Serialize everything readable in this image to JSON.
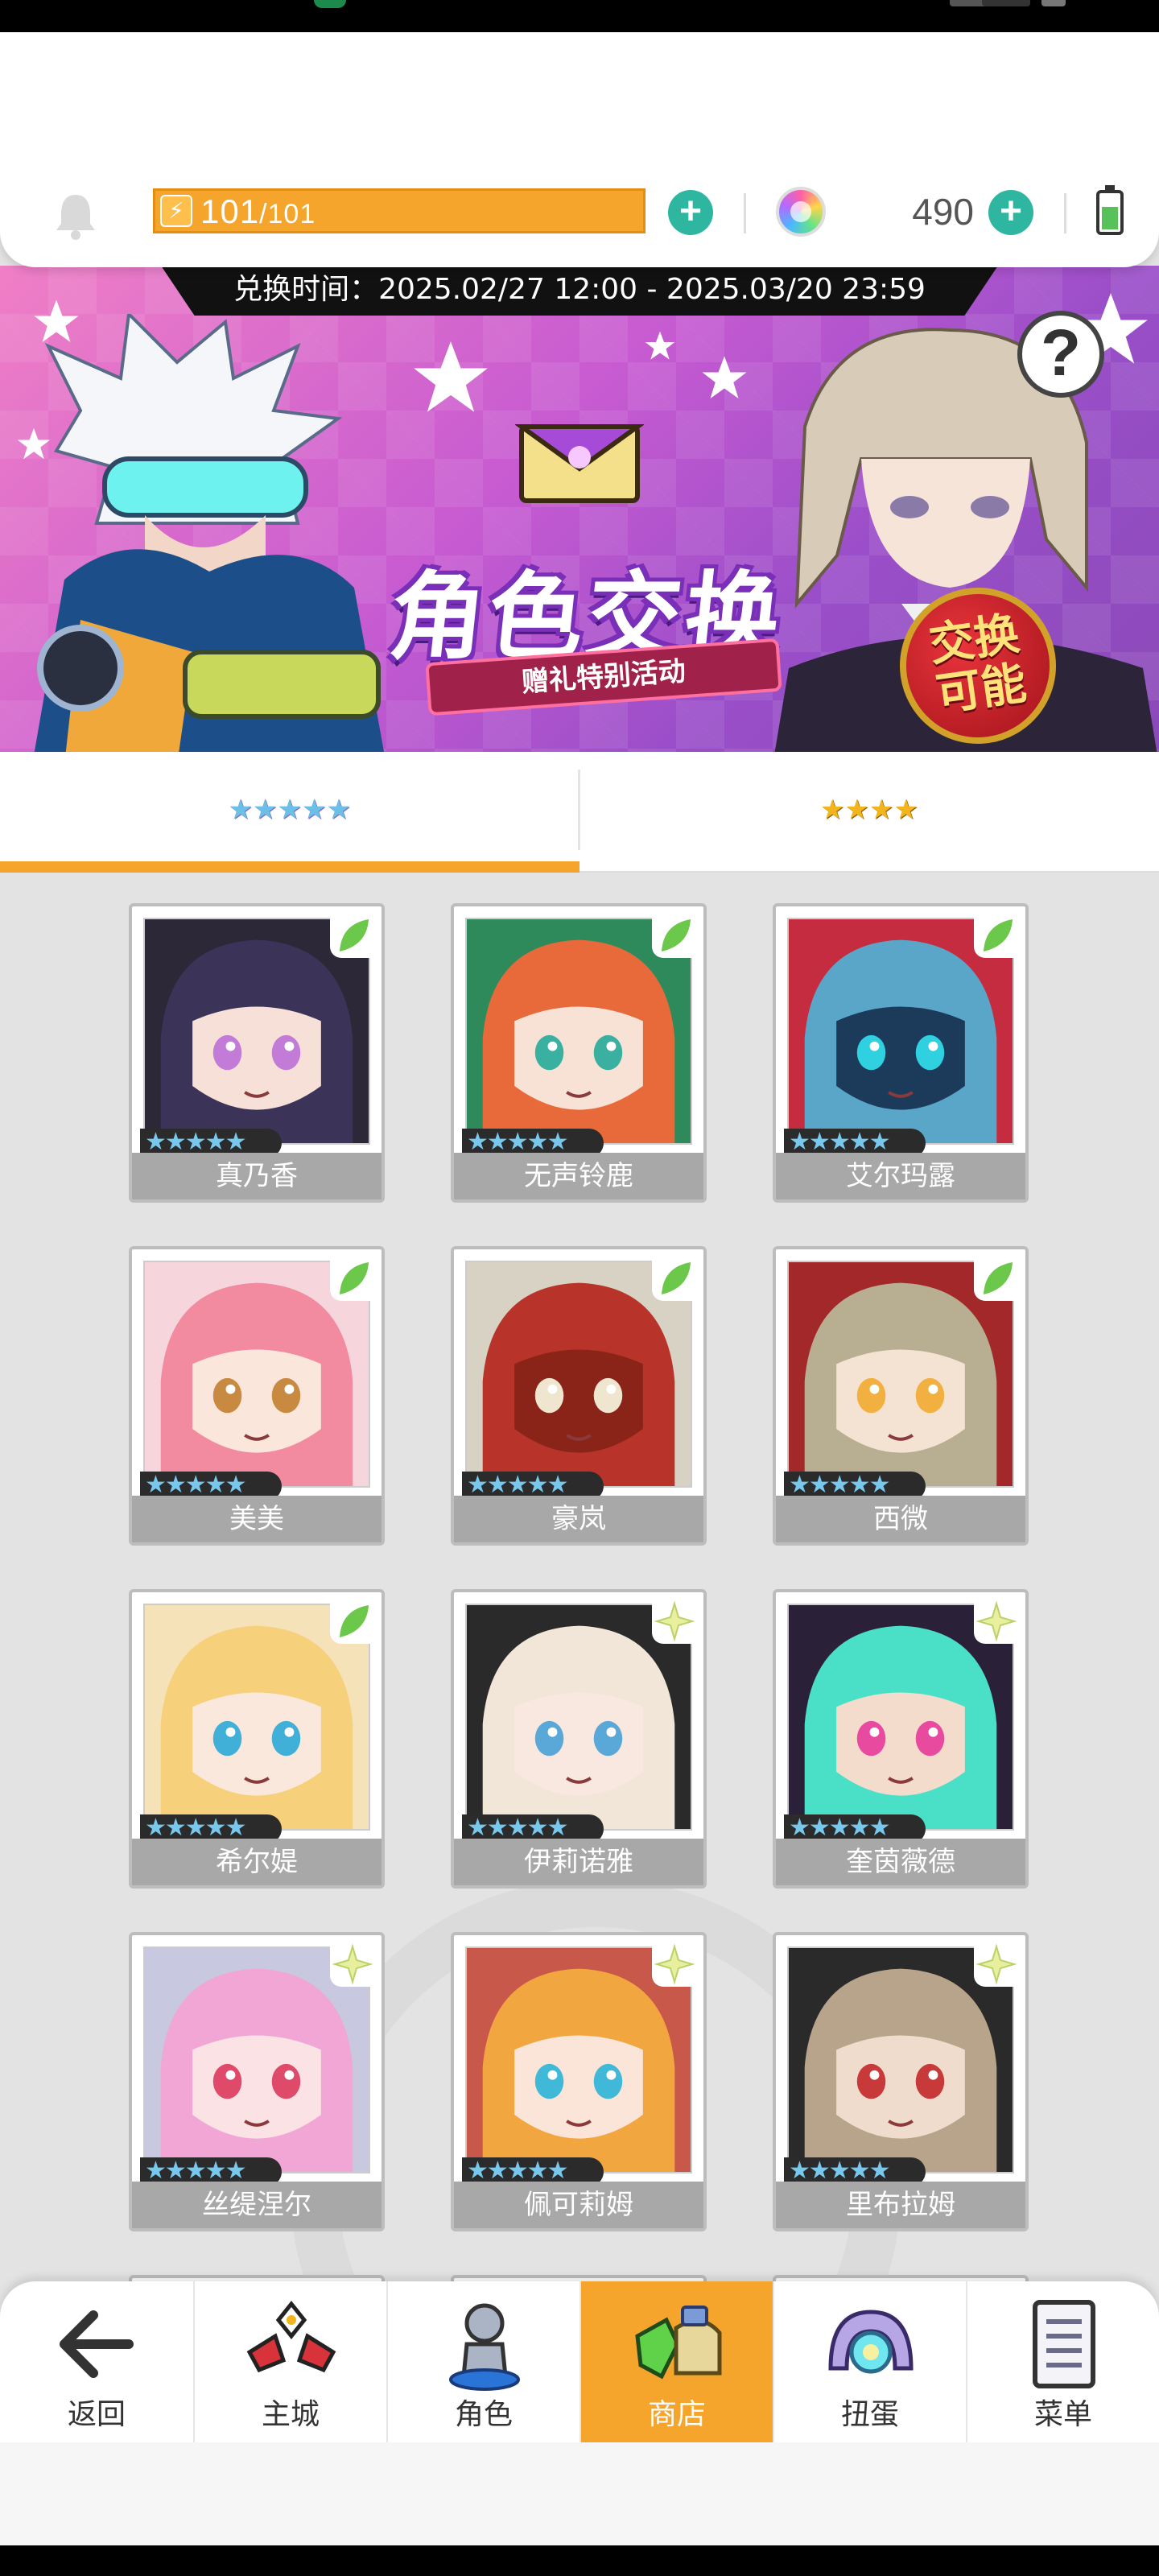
{
  "header": {
    "energy_current": "101",
    "energy_max": "/101",
    "gem_count": "490"
  },
  "banner": {
    "exchange_time": "兑换时间：2025.02/27 12:00 - 2025.03/20 23:59",
    "title": "角色交换",
    "subtitle": "赠礼特别活动",
    "badge_line1": "交换",
    "badge_line2": "可能",
    "help_label": "?"
  },
  "tabs": [
    {
      "stars": "★★★★★",
      "rarity": 5,
      "selected": true
    },
    {
      "stars": "★★★★",
      "rarity": 4,
      "selected": false
    }
  ],
  "characters": [
    {
      "name": "真乃香",
      "stars": "★★★★★"
    },
    {
      "name": "无声铃鹿",
      "stars": "★★★★★"
    },
    {
      "name": "艾尔玛露",
      "stars": "★★★★★"
    },
    {
      "name": "美美",
      "stars": "★★★★★"
    },
    {
      "name": "豪岚",
      "stars": "★★★★★"
    },
    {
      "name": "西微",
      "stars": "★★★★★"
    },
    {
      "name": "希尔媞",
      "stars": "★★★★★"
    },
    {
      "name": "伊莉诺雅",
      "stars": "★★★★★"
    },
    {
      "name": "奎茵薇德",
      "stars": "★★★★★"
    },
    {
      "name": "丝缇涅尔",
      "stars": "★★★★★"
    },
    {
      "name": "佩可莉姆",
      "stars": "★★★★★"
    },
    {
      "name": "里布拉姆",
      "stars": "★★★★★"
    }
  ],
  "nav": [
    {
      "label": "返回",
      "icon": "back-arrow-icon"
    },
    {
      "label": "主城",
      "icon": "castle-icon"
    },
    {
      "label": "角色",
      "icon": "character-icon"
    },
    {
      "label": "商店",
      "icon": "shop-icon",
      "active": true
    },
    {
      "label": "扭蛋",
      "icon": "gacha-icon"
    },
    {
      "label": "菜单",
      "icon": "menu-list-icon"
    }
  ],
  "colors": {
    "accent": "#f5a52b",
    "plus_button": "#2fb6a0",
    "card_name_bg": "#a8a8a8"
  }
}
